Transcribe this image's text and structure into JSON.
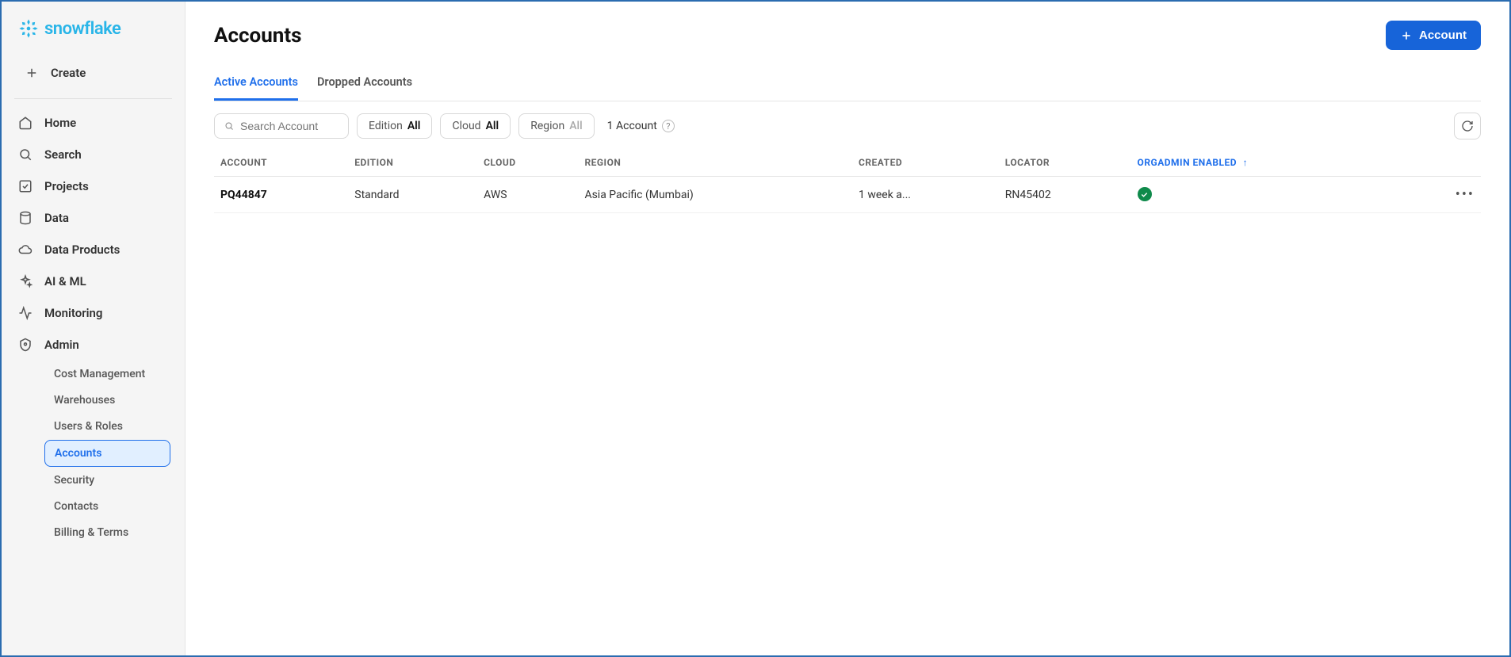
{
  "brand": "snowflake",
  "sidebar": {
    "create_label": "Create",
    "items": [
      {
        "label": "Home"
      },
      {
        "label": "Search"
      },
      {
        "label": "Projects"
      },
      {
        "label": "Data"
      },
      {
        "label": "Data Products"
      },
      {
        "label": "AI & ML"
      },
      {
        "label": "Monitoring"
      },
      {
        "label": "Admin"
      }
    ],
    "admin_sub": [
      {
        "label": "Cost Management"
      },
      {
        "label": "Warehouses"
      },
      {
        "label": "Users & Roles"
      },
      {
        "label": "Accounts"
      },
      {
        "label": "Security"
      },
      {
        "label": "Contacts"
      },
      {
        "label": "Billing & Terms"
      }
    ]
  },
  "page": {
    "title": "Accounts",
    "primary_button": "Account"
  },
  "tabs": [
    {
      "label": "Active Accounts",
      "active": true
    },
    {
      "label": "Dropped Accounts",
      "active": false
    }
  ],
  "filters": {
    "search_placeholder": "Search Account",
    "edition": {
      "label": "Edition",
      "value": "All"
    },
    "cloud": {
      "label": "Cloud",
      "value": "All"
    },
    "region": {
      "label": "Region",
      "value": "All"
    },
    "count_text": "1 Account"
  },
  "table": {
    "columns": [
      "ACCOUNT",
      "EDITION",
      "CLOUD",
      "REGION",
      "CREATED",
      "LOCATOR",
      "ORGADMIN ENABLED"
    ],
    "sorted_column": "ORGADMIN ENABLED",
    "sort_dir": "asc",
    "rows": [
      {
        "account": "PQ44847",
        "edition": "Standard",
        "cloud": "AWS",
        "region": "Asia Pacific (Mumbai)",
        "created": "1 week a...",
        "locator": "RN45402",
        "orgadmin_enabled": true
      }
    ]
  }
}
